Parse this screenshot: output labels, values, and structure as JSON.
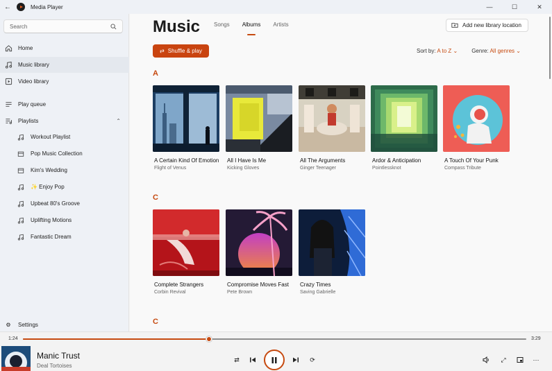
{
  "window": {
    "title": "Media Player"
  },
  "sidebar": {
    "search_placeholder": "Search",
    "items": [
      {
        "label": "Home",
        "icon": "home-icon"
      },
      {
        "label": "Music library",
        "icon": "music-note-icon"
      },
      {
        "label": "Video library",
        "icon": "video-icon"
      },
      {
        "label": "Play queue",
        "icon": "queue-icon"
      },
      {
        "label": "Playlists",
        "icon": "playlist-icon"
      }
    ],
    "playlists": [
      "Workout Playlist",
      "Pop Music Collection",
      "Kim's Wedding",
      "✨ Enjoy Pop",
      "Upbeat 80's Groove",
      "Uplifting Motions",
      "Fantastic Dream"
    ],
    "settings_label": "Settings"
  },
  "main": {
    "title": "Music",
    "tabs": [
      "Songs",
      "Albums",
      "Artists"
    ],
    "active_tab": "Albums",
    "add_location_label": "Add new library location",
    "shuffle_label": "Shuffle & play",
    "sort_label": "Sort by:",
    "sort_value": "A to Z",
    "genre_label": "Genre:",
    "genre_value": "All genres",
    "sections": [
      {
        "letter": "A",
        "albums": [
          {
            "title": "A Certain Kind Of Emotion",
            "artist": "Flight of Venus"
          },
          {
            "title": "All I Have Is Me",
            "artist": "Kicking Gloves"
          },
          {
            "title": "All The Arguments",
            "artist": "Ginger Teenager"
          },
          {
            "title": "Ardor & Anticipation",
            "artist": "Pointlessknot"
          },
          {
            "title": "A Touch Of Your Punk",
            "artist": "Compass Tribute"
          }
        ]
      },
      {
        "letter": "C",
        "albums": [
          {
            "title": "Complete Strangers",
            "artist": "Corbin Revival"
          },
          {
            "title": "Compromise Moves Fast",
            "artist": "Pete Brown"
          },
          {
            "title": "Crazy Times",
            "artist": "Saving Gabrielle"
          }
        ]
      },
      {
        "letter": "C",
        "albums": []
      }
    ]
  },
  "player": {
    "elapsed": "1:24",
    "total": "3:29",
    "progress": 0.37,
    "track_title": "Manic Trust",
    "track_artist": "Deal Tortoises"
  },
  "colors": {
    "accent": "#c64a10"
  }
}
